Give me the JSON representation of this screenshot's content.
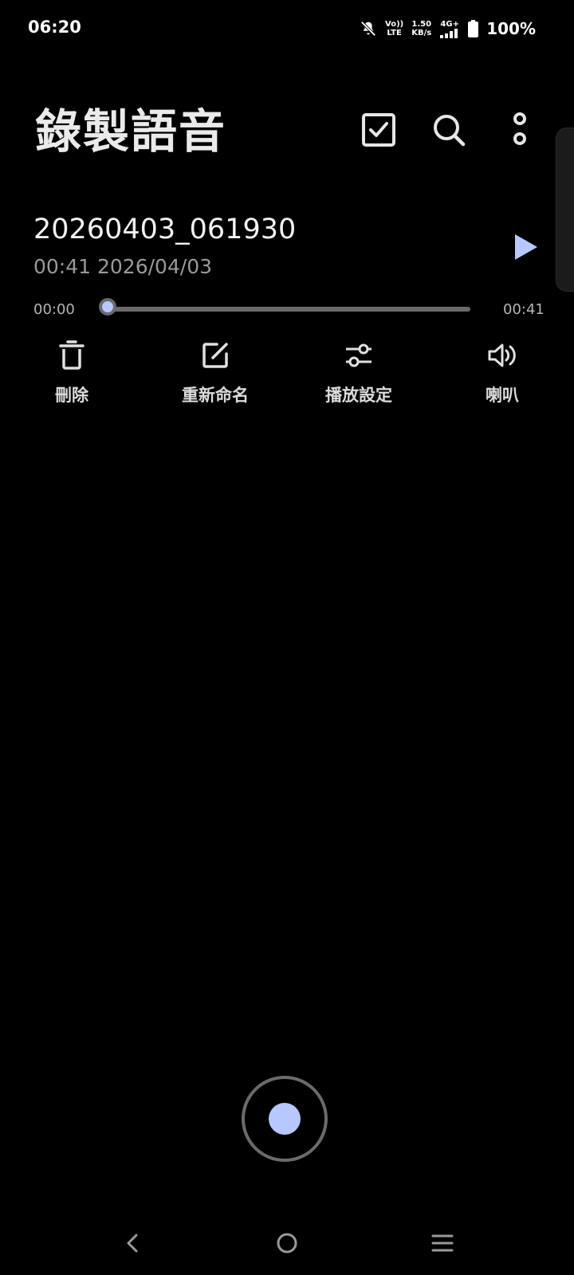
{
  "status_bar": {
    "time": "06:20",
    "volte_top": "Vo))",
    "volte_bottom": "LTE",
    "speed_value": "1.50",
    "speed_unit": "KB/s",
    "network": "4G+",
    "battery": "100%"
  },
  "header": {
    "title": "錄製語音",
    "icons": [
      "select-checkbox-icon",
      "search-icon",
      "more-options-icon"
    ]
  },
  "recording": {
    "name": "20260403_061930",
    "duration": "00:41",
    "date": "2026/04/03",
    "position_start": "00:00",
    "position_end": "00:41",
    "progress": 0.0
  },
  "actions": [
    {
      "label": "刪除",
      "icon": "trash-icon"
    },
    {
      "label": "重新命名",
      "icon": "edit-icon"
    },
    {
      "label": "播放設定",
      "icon": "sliders-icon"
    },
    {
      "label": "喇叭",
      "icon": "speaker-icon"
    }
  ],
  "colors": {
    "accent": "#b6c8ff",
    "background": "#000000"
  }
}
